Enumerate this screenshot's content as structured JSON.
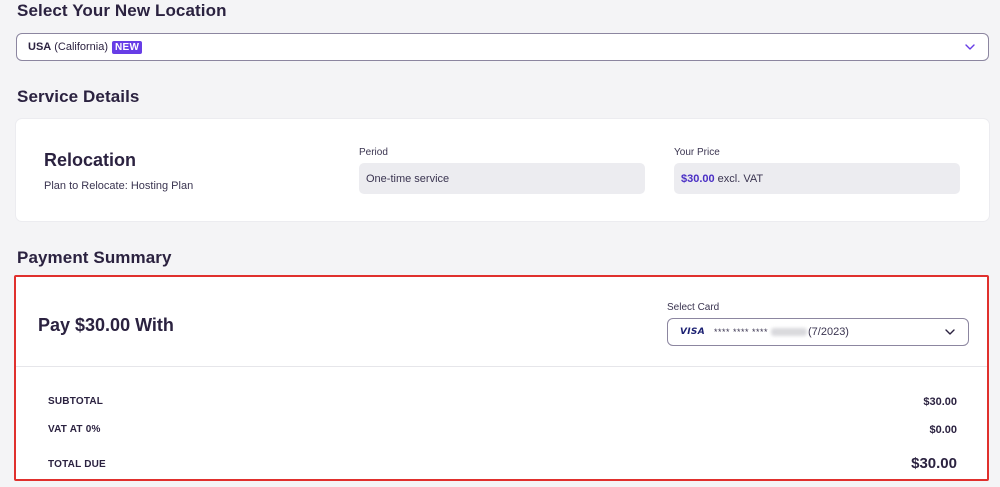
{
  "location": {
    "heading": "Select Your New Location",
    "country": "USA",
    "region": "(California)",
    "badge": "NEW"
  },
  "service": {
    "heading": "Service Details",
    "title": "Relocation",
    "subtitle": "Plan to Relocate: Hosting Plan",
    "period_label": "Period",
    "period_value": "One-time service",
    "price_label": "Your Price",
    "price_amount": "$30.00",
    "price_suffix": "excl. VAT"
  },
  "payment": {
    "heading": "Payment Summary",
    "title": "Pay $30.00 With",
    "card_label": "Select Card",
    "card_brand": "VISA",
    "card_mask": "**** **** ****",
    "card_expiry": "(7/2023)",
    "rows": [
      {
        "label": "SUBTOTAL",
        "value": "$30.00"
      },
      {
        "label": "VAT AT 0%",
        "value": "$0.00"
      },
      {
        "label": "TOTAL DUE",
        "value": "$30.00"
      }
    ]
  },
  "colors": {
    "accent": "#673de6",
    "highlight_border": "#e0302d",
    "background": "#f4f4f6"
  }
}
